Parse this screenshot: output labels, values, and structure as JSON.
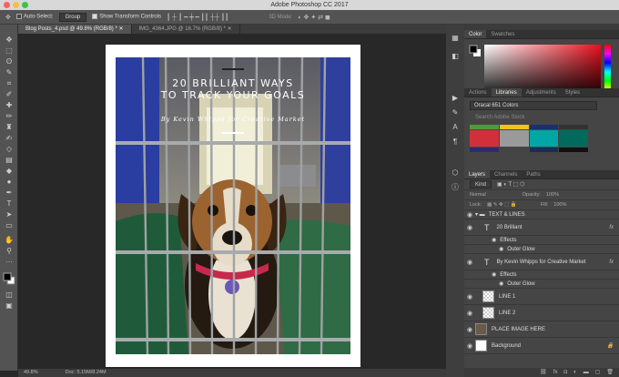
{
  "window": {
    "title": "Adobe Photoshop CC 2017"
  },
  "options_bar": {
    "auto_select_label": "Auto-Select:",
    "auto_select_value": "Group",
    "show_transform_label": "Show Transform Controls",
    "mode_3d": "3D Mode:"
  },
  "tabs": [
    {
      "label": "Blog Posts_4.psd @ 49.8% (RGB/8) *"
    },
    {
      "label": "IMG_4364.JPG @ 16.7% (RGB/8) *"
    }
  ],
  "document": {
    "title_line1": "20 BRILLIANT WAYS",
    "title_line2": "TO TRACK YOUR GOALS",
    "subtitle": "By Kevin Whipps for Creative Market"
  },
  "status": {
    "zoom": "49.8%",
    "doc_size": "Doc: 5.15M/8.24M"
  },
  "color_panel": {
    "tabs": [
      "Color",
      "Swatches"
    ],
    "fg": "#000000",
    "bg": "#ffffff",
    "hue": "#e8101e"
  },
  "libraries_panel": {
    "tabs": [
      "Actions",
      "Libraries",
      "Adjustments",
      "Styles"
    ],
    "library_name": "Oracal 651 Colors",
    "search_placeholder": "Search Adobe Stock",
    "swatch_colors": [
      "#4d9b3a",
      "#f0c419",
      "#1d2f6b",
      "#333333",
      "#d1303a",
      "#9a9a9a",
      "#00a6a6",
      "#006b5c",
      "#2b2b6e",
      "#444444",
      "#1d2a5c",
      "#111111"
    ]
  },
  "layers_panel": {
    "tabs": [
      "Layers",
      "Channels",
      "Paths"
    ],
    "filter": "Kind",
    "blend_mode": "Normal",
    "opacity_label": "Opacity:",
    "opacity": "100%",
    "lock_label": "Lock:",
    "fill_label": "Fill:",
    "fill": "100%",
    "layers": [
      {
        "name": "TEXT & LINES",
        "kind": "group"
      },
      {
        "name": "20 Brilliant",
        "kind": "text",
        "fx": "fx"
      },
      {
        "name": "Effects",
        "kind": "effects"
      },
      {
        "name": "Outer Glow",
        "kind": "effect"
      },
      {
        "name": "By Kevin Whipps for Creative Market",
        "kind": "text",
        "fx": "fx"
      },
      {
        "name": "Effects",
        "kind": "effects"
      },
      {
        "name": "Outer Glow",
        "kind": "effect"
      },
      {
        "name": "LINE 1",
        "kind": "shape"
      },
      {
        "name": "LINE 2",
        "kind": "shape"
      },
      {
        "name": "PLACE IMAGE HERE",
        "kind": "image"
      },
      {
        "name": "Background",
        "kind": "background"
      }
    ]
  }
}
